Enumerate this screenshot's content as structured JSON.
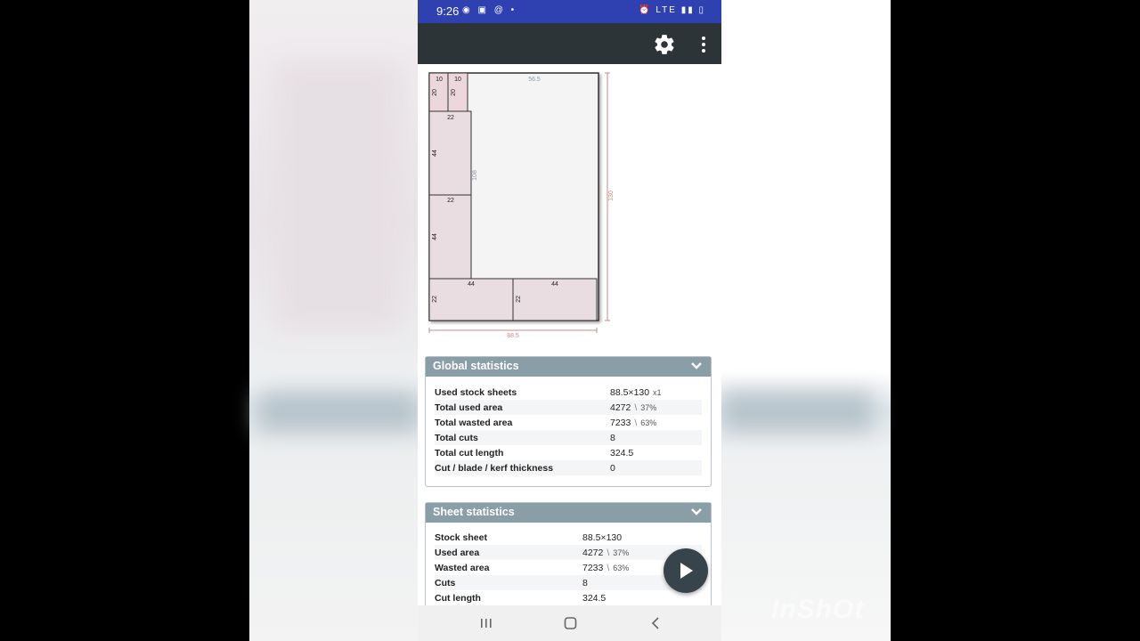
{
  "status_bar": {
    "time": "9:26",
    "network": "LTE"
  },
  "app_bar": {
    "settings_icon": "gear-icon",
    "menu_icon": "more-vert-icon"
  },
  "diagram": {
    "sheet_width_label": "88.5",
    "sheet_height_label": "130",
    "waste_width_label": "56.5",
    "waste_height_label": "108",
    "pieces": [
      {
        "w": "10",
        "h": "20"
      },
      {
        "w": "10",
        "h": "20"
      },
      {
        "w": "22",
        "h": "44"
      },
      {
        "w": "22",
        "h": "44"
      },
      {
        "w": "44",
        "h": "22"
      },
      {
        "w": "44",
        "h": "22"
      }
    ]
  },
  "global_statistics": {
    "title": "Global statistics",
    "rows": [
      {
        "label": "Used stock sheets",
        "value": "88.5×130",
        "extra": "x1"
      },
      {
        "label": "Total used area",
        "value": "4272",
        "sep": "\\",
        "pct": "37%"
      },
      {
        "label": "Total wasted area",
        "value": "7233",
        "sep": "\\",
        "pct": "63%"
      },
      {
        "label": "Total cuts",
        "value": "8"
      },
      {
        "label": "Total cut length",
        "value": "324.5"
      },
      {
        "label": "Cut / blade / kerf thickness",
        "value": "0"
      }
    ]
  },
  "sheet_statistics": {
    "title": "Sheet statistics",
    "rows": [
      {
        "label": "Stock sheet",
        "value": "88.5×130"
      },
      {
        "label": "Used area",
        "value": "4272",
        "sep": "\\",
        "pct": "37%"
      },
      {
        "label": "Wasted area",
        "value": "7233",
        "sep": "\\",
        "pct": "63%"
      },
      {
        "label": "Cuts",
        "value": "8"
      },
      {
        "label": "Cut length",
        "value": "324.5"
      }
    ]
  },
  "fab_icon": "play-icon",
  "watermark": "InShOt"
}
